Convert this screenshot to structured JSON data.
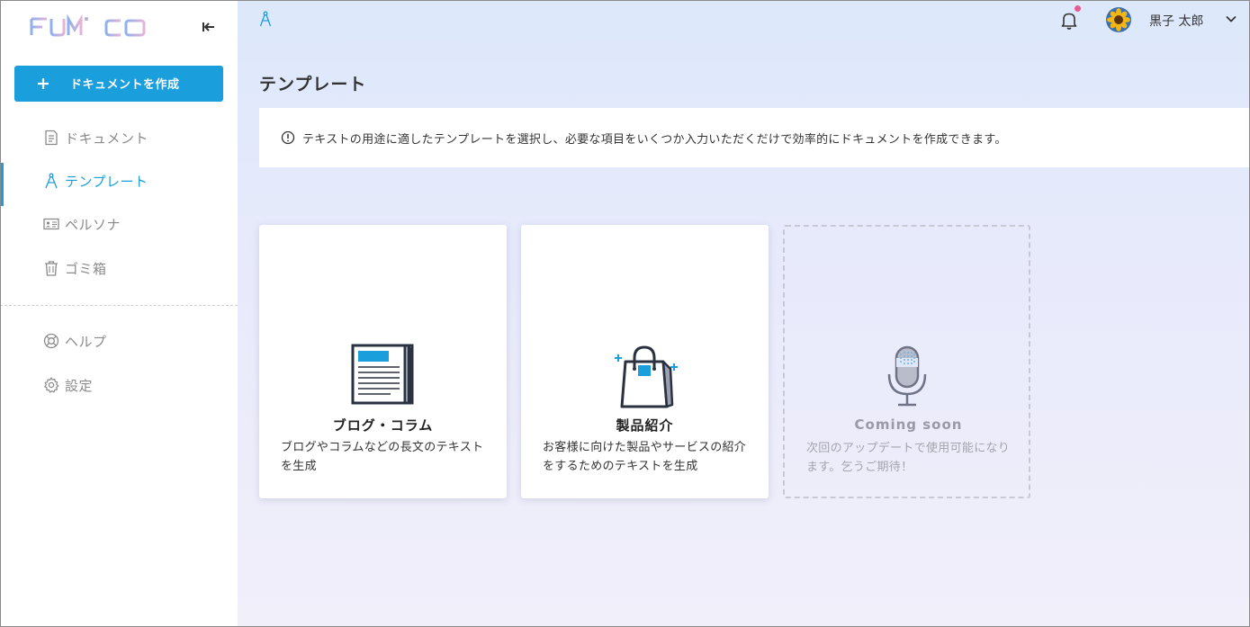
{
  "app": {
    "logo_text": "FUMI-CO"
  },
  "sidebar": {
    "create_button_label": "ドキュメントを作成",
    "items": [
      {
        "label": "ドキュメント",
        "icon": "document-icon",
        "active": false
      },
      {
        "label": "テンプレート",
        "icon": "compass-icon",
        "active": true
      },
      {
        "label": "ペルソナ",
        "icon": "id-card-icon",
        "active": false
      },
      {
        "label": "ゴミ箱",
        "icon": "trash-icon",
        "active": false
      }
    ],
    "secondary_items": [
      {
        "label": "ヘルプ",
        "icon": "lifebuoy-icon"
      },
      {
        "label": "設定",
        "icon": "gear-icon"
      }
    ]
  },
  "header": {
    "user_name": "黒子 太郎",
    "notification_dot_color": "#e85a94"
  },
  "main": {
    "title": "テンプレート",
    "info_text": "テキストの用途に適したテンプレートを選択し、必要な項目をいくつか入力いただくだけで効率的にドキュメントを作成できます。",
    "cards": [
      {
        "title": "ブログ・コラム",
        "description": "ブログやコラムなどの長文のテキストを生成",
        "icon": "newspaper-icon"
      },
      {
        "title": "製品紹介",
        "description": "お客様に向けた製品やサービスの紹介をするためのテキストを生成",
        "icon": "shopping-bag-icon"
      },
      {
        "title": "Coming soon",
        "description": "次回のアップデートで使用可能になります。乞うご期待！",
        "icon": "microphone-icon"
      }
    ]
  },
  "colors": {
    "accent": "#1a9edc",
    "sidebar_bg": "#ffffff",
    "main_bg_top": "#dde8fb",
    "main_bg_bottom": "#f1effa"
  }
}
